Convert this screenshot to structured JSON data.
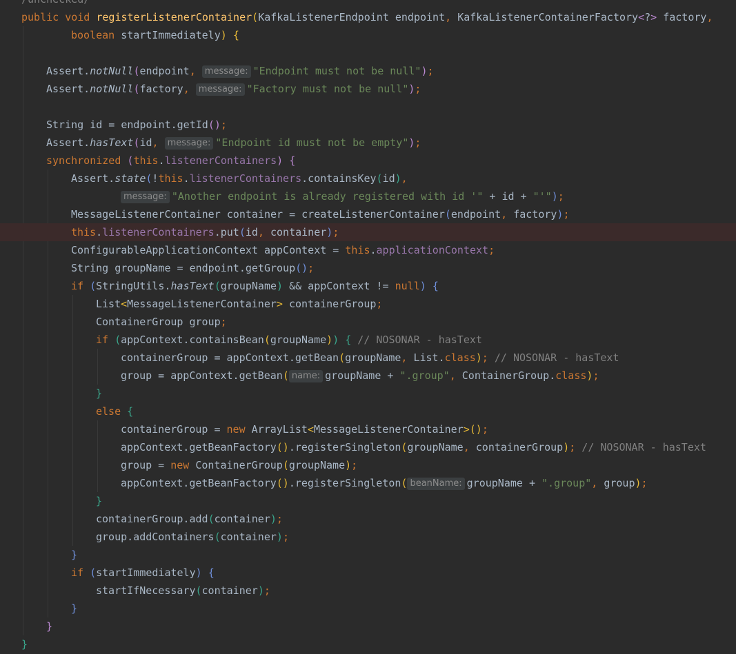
{
  "editor": {
    "lines": [
      {
        "indent": 0,
        "tokens": [
          {
            "t": "/unchecked/",
            "c": "cm"
          }
        ]
      },
      {
        "indent": 0,
        "tokens": [
          {
            "t": "public void ",
            "c": "kw"
          },
          {
            "t": "registerListenerContainer",
            "c": "fn"
          },
          {
            "t": "(",
            "c": "pa"
          },
          {
            "t": "KafkaListenerEndpoint endpoint"
          },
          {
            "t": ", ",
            "c": "kw"
          },
          {
            "t": "KafkaListenerContainerFactory"
          },
          {
            "t": "<",
            "c": "pb"
          },
          {
            "t": "?"
          },
          {
            "t": ">",
            "c": "pb"
          },
          {
            "t": " factory"
          },
          {
            "t": ",",
            "c": "kw"
          }
        ]
      },
      {
        "indent": 2,
        "tokens": [
          {
            "t": "boolean ",
            "c": "kw"
          },
          {
            "t": "startImmediately"
          },
          {
            "t": ")",
            "c": "pa"
          },
          {
            "t": " "
          },
          {
            "t": "{",
            "c": "pa"
          }
        ]
      },
      {
        "indent": 0,
        "tokens": []
      },
      {
        "indent": 1,
        "tokens": [
          {
            "t": "Assert."
          },
          {
            "t": "notNull",
            "c": "it"
          },
          {
            "t": "(",
            "c": "pb"
          },
          {
            "t": "endpoint"
          },
          {
            "t": ", ",
            "c": "kw"
          },
          {
            "hint": "message:"
          },
          {
            "t": "\"Endpoint must not be null\"",
            "c": "str"
          },
          {
            "t": ")",
            "c": "pb"
          },
          {
            "t": ";",
            "c": "kw"
          }
        ]
      },
      {
        "indent": 1,
        "tokens": [
          {
            "t": "Assert."
          },
          {
            "t": "notNull",
            "c": "it"
          },
          {
            "t": "(",
            "c": "pb"
          },
          {
            "t": "factory"
          },
          {
            "t": ", ",
            "c": "kw"
          },
          {
            "hint": "message:"
          },
          {
            "t": "\"Factory must not be null\"",
            "c": "str"
          },
          {
            "t": ")",
            "c": "pb"
          },
          {
            "t": ";",
            "c": "kw"
          }
        ]
      },
      {
        "indent": 0,
        "tokens": []
      },
      {
        "indent": 1,
        "tokens": [
          {
            "t": "String id = endpoint.getId"
          },
          {
            "t": "()",
            "c": "pb"
          },
          {
            "t": ";",
            "c": "kw"
          }
        ]
      },
      {
        "indent": 1,
        "tokens": [
          {
            "t": "Assert."
          },
          {
            "t": "hasText",
            "c": "it"
          },
          {
            "t": "(",
            "c": "pb"
          },
          {
            "t": "id"
          },
          {
            "t": ", ",
            "c": "kw"
          },
          {
            "hint": "message:"
          },
          {
            "t": "\"Endpoint id must not be empty\"",
            "c": "str"
          },
          {
            "t": ")",
            "c": "pb"
          },
          {
            "t": ";",
            "c": "kw"
          }
        ]
      },
      {
        "indent": 1,
        "tokens": [
          {
            "t": "synchronized ",
            "c": "kw"
          },
          {
            "t": "(",
            "c": "pb"
          },
          {
            "t": "this",
            "c": "kw"
          },
          {
            "t": "."
          },
          {
            "t": "listenerContainers",
            "c": "fld"
          },
          {
            "t": ")",
            "c": "pb"
          },
          {
            "t": " "
          },
          {
            "t": "{",
            "c": "pb"
          }
        ]
      },
      {
        "indent": 2,
        "tokens": [
          {
            "t": "Assert."
          },
          {
            "t": "state",
            "c": "it"
          },
          {
            "t": "(",
            "c": "pc"
          },
          {
            "t": "!"
          },
          {
            "t": "this",
            "c": "kw"
          },
          {
            "t": "."
          },
          {
            "t": "listenerContainers",
            "c": "fld"
          },
          {
            "t": ".containsKey"
          },
          {
            "t": "(",
            "c": "pd"
          },
          {
            "t": "id"
          },
          {
            "t": ")",
            "c": "pd"
          },
          {
            "t": ",",
            "c": "kw"
          }
        ]
      },
      {
        "indent": 4,
        "tokens": [
          {
            "hint": "message:"
          },
          {
            "t": "\"Another endpoint is already registered with id '\"",
            "c": "str"
          },
          {
            "t": " + id + "
          },
          {
            "t": "\"'\"",
            "c": "str"
          },
          {
            "t": ")",
            "c": "pc"
          },
          {
            "t": ";",
            "c": "kw"
          }
        ]
      },
      {
        "indent": 2,
        "tokens": [
          {
            "t": "MessageListenerContainer container = createListenerContainer"
          },
          {
            "t": "(",
            "c": "pc"
          },
          {
            "t": "endpoint"
          },
          {
            "t": ", ",
            "c": "kw"
          },
          {
            "t": "factory"
          },
          {
            "t": ")",
            "c": "pc"
          },
          {
            "t": ";",
            "c": "kw"
          }
        ]
      },
      {
        "indent": 2,
        "hl": true,
        "tokens": [
          {
            "t": "this",
            "c": "kw"
          },
          {
            "t": "."
          },
          {
            "t": "listenerContainers",
            "c": "fld"
          },
          {
            "t": ".put"
          },
          {
            "t": "(",
            "c": "pc"
          },
          {
            "t": "id"
          },
          {
            "t": ", ",
            "c": "kw"
          },
          {
            "t": "container"
          },
          {
            "t": ")",
            "c": "pc"
          },
          {
            "t": ";",
            "c": "kw"
          }
        ]
      },
      {
        "indent": 2,
        "tokens": [
          {
            "t": "ConfigurableApplicationContext appContext = "
          },
          {
            "t": "this",
            "c": "kw"
          },
          {
            "t": "."
          },
          {
            "t": "applicationContext",
            "c": "fld"
          },
          {
            "t": ";",
            "c": "kw"
          }
        ]
      },
      {
        "indent": 2,
        "tokens": [
          {
            "t": "String groupName = endpoint.getGroup"
          },
          {
            "t": "()",
            "c": "pc"
          },
          {
            "t": ";",
            "c": "kw"
          }
        ]
      },
      {
        "indent": 2,
        "tokens": [
          {
            "t": "if ",
            "c": "kw"
          },
          {
            "t": "(",
            "c": "pc"
          },
          {
            "t": "StringUtils."
          },
          {
            "t": "hasText",
            "c": "it"
          },
          {
            "t": "(",
            "c": "pd"
          },
          {
            "t": "groupName"
          },
          {
            "t": ")",
            "c": "pd"
          },
          {
            "t": " && appContext != "
          },
          {
            "t": "null",
            "c": "kw"
          },
          {
            "t": ")",
            "c": "pc"
          },
          {
            "t": " "
          },
          {
            "t": "{",
            "c": "pc"
          }
        ]
      },
      {
        "indent": 3,
        "tokens": [
          {
            "t": "List"
          },
          {
            "t": "<",
            "c": "pa"
          },
          {
            "t": "MessageListenerContainer"
          },
          {
            "t": ">",
            "c": "pa"
          },
          {
            "t": " containerGroup"
          },
          {
            "t": ";",
            "c": "kw"
          }
        ]
      },
      {
        "indent": 3,
        "tokens": [
          {
            "t": "ContainerGroup group"
          },
          {
            "t": ";",
            "c": "kw"
          }
        ]
      },
      {
        "indent": 3,
        "tokens": [
          {
            "t": "if ",
            "c": "kw"
          },
          {
            "t": "(",
            "c": "pd"
          },
          {
            "t": "appContext.containsBean"
          },
          {
            "t": "(",
            "c": "pa"
          },
          {
            "t": "groupName"
          },
          {
            "t": ")",
            "c": "pa"
          },
          {
            "t": ")",
            "c": "pd"
          },
          {
            "t": " "
          },
          {
            "t": "{",
            "c": "pd"
          },
          {
            "t": " // NOSONAR - hasText",
            "c": "cm"
          }
        ]
      },
      {
        "indent": 4,
        "tokens": [
          {
            "t": "containerGroup = appContext.getBean"
          },
          {
            "t": "(",
            "c": "pa"
          },
          {
            "t": "groupName"
          },
          {
            "t": ", ",
            "c": "kw"
          },
          {
            "t": "List."
          },
          {
            "t": "class",
            "c": "kw"
          },
          {
            "t": ")",
            "c": "pa"
          },
          {
            "t": ";",
            "c": "kw"
          },
          {
            "t": " // NOSONAR - hasText",
            "c": "cm"
          }
        ]
      },
      {
        "indent": 4,
        "tokens": [
          {
            "t": "group = appContext.getBean"
          },
          {
            "t": "(",
            "c": "pa"
          },
          {
            "hint": "name:"
          },
          {
            "t": "groupName + "
          },
          {
            "t": "\".group\"",
            "c": "str"
          },
          {
            "t": ", ",
            "c": "kw"
          },
          {
            "t": "ContainerGroup."
          },
          {
            "t": "class",
            "c": "kw"
          },
          {
            "t": ")",
            "c": "pa"
          },
          {
            "t": ";",
            "c": "kw"
          }
        ]
      },
      {
        "indent": 3,
        "tokens": [
          {
            "t": "}",
            "c": "pd"
          }
        ]
      },
      {
        "indent": 3,
        "tokens": [
          {
            "t": "else ",
            "c": "kw"
          },
          {
            "t": "{",
            "c": "pd"
          }
        ]
      },
      {
        "indent": 4,
        "tokens": [
          {
            "t": "containerGroup = "
          },
          {
            "t": "new ",
            "c": "kw"
          },
          {
            "t": "ArrayList"
          },
          {
            "t": "<",
            "c": "pa"
          },
          {
            "t": "MessageListenerContainer"
          },
          {
            "t": ">",
            "c": "pa"
          },
          {
            "t": "()",
            "c": "pa"
          },
          {
            "t": ";",
            "c": "kw"
          }
        ]
      },
      {
        "indent": 4,
        "tokens": [
          {
            "t": "appContext.getBeanFactory"
          },
          {
            "t": "()",
            "c": "pa"
          },
          {
            "t": ".registerSingleton"
          },
          {
            "t": "(",
            "c": "pa"
          },
          {
            "t": "groupName"
          },
          {
            "t": ", ",
            "c": "kw"
          },
          {
            "t": "containerGroup"
          },
          {
            "t": ")",
            "c": "pa"
          },
          {
            "t": ";",
            "c": "kw"
          },
          {
            "t": " // NOSONAR - hasText",
            "c": "cm"
          }
        ]
      },
      {
        "indent": 4,
        "tokens": [
          {
            "t": "group = "
          },
          {
            "t": "new ",
            "c": "kw"
          },
          {
            "t": "ContainerGroup"
          },
          {
            "t": "(",
            "c": "pa"
          },
          {
            "t": "groupName"
          },
          {
            "t": ")",
            "c": "pa"
          },
          {
            "t": ";",
            "c": "kw"
          }
        ]
      },
      {
        "indent": 4,
        "tokens": [
          {
            "t": "appContext.getBeanFactory"
          },
          {
            "t": "()",
            "c": "pa"
          },
          {
            "t": ".registerSingleton"
          },
          {
            "t": "(",
            "c": "pa"
          },
          {
            "hint": "beanName:"
          },
          {
            "t": "groupName + "
          },
          {
            "t": "\".group\"",
            "c": "str"
          },
          {
            "t": ", ",
            "c": "kw"
          },
          {
            "t": "group"
          },
          {
            "t": ")",
            "c": "pa"
          },
          {
            "t": ";",
            "c": "kw"
          }
        ]
      },
      {
        "indent": 3,
        "tokens": [
          {
            "t": "}",
            "c": "pd"
          }
        ]
      },
      {
        "indent": 3,
        "tokens": [
          {
            "t": "containerGroup.add"
          },
          {
            "t": "(",
            "c": "pd"
          },
          {
            "t": "container"
          },
          {
            "t": ")",
            "c": "pd"
          },
          {
            "t": ";",
            "c": "kw"
          }
        ]
      },
      {
        "indent": 3,
        "tokens": [
          {
            "t": "group.addContainers"
          },
          {
            "t": "(",
            "c": "pd"
          },
          {
            "t": "container"
          },
          {
            "t": ")",
            "c": "pd"
          },
          {
            "t": ";",
            "c": "kw"
          }
        ]
      },
      {
        "indent": 2,
        "tokens": [
          {
            "t": "}",
            "c": "pc"
          }
        ]
      },
      {
        "indent": 2,
        "tokens": [
          {
            "t": "if ",
            "c": "kw"
          },
          {
            "t": "(",
            "c": "pc"
          },
          {
            "t": "startImmediately"
          },
          {
            "t": ")",
            "c": "pc"
          },
          {
            "t": " "
          },
          {
            "t": "{",
            "c": "pc"
          }
        ]
      },
      {
        "indent": 3,
        "tokens": [
          {
            "t": "startIfNecessary"
          },
          {
            "t": "(",
            "c": "pd"
          },
          {
            "t": "container"
          },
          {
            "t": ")",
            "c": "pd"
          },
          {
            "t": ";",
            "c": "kw"
          }
        ]
      },
      {
        "indent": 2,
        "tokens": [
          {
            "t": "}",
            "c": "pc"
          }
        ]
      },
      {
        "indent": 1,
        "tokens": [
          {
            "t": "}",
            "c": "pb"
          }
        ]
      },
      {
        "indent": 0,
        "tokens": [
          {
            "t": "}",
            "c": "pd"
          }
        ]
      }
    ]
  }
}
